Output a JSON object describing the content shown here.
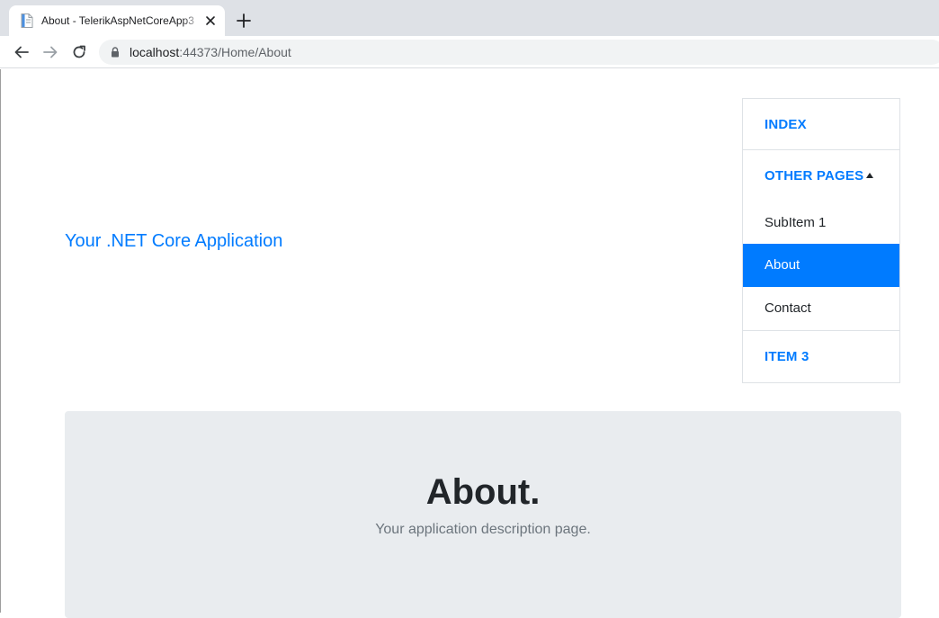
{
  "browser": {
    "tab": {
      "title": "About - TelerikAspNetCoreApp3",
      "favicon": "document-icon"
    },
    "address": {
      "host": "localhost",
      "path": ":44373/Home/About"
    },
    "icons": {
      "back": "arrow-left-icon",
      "forward": "arrow-right-icon",
      "reload": "reload-icon",
      "lock": "lock-icon",
      "close": "close-icon",
      "new_tab": "plus-icon"
    }
  },
  "header": {
    "brand": "Your .NET Core Application"
  },
  "menu": {
    "items": [
      {
        "label": "Index"
      },
      {
        "label": "Other Pages",
        "expanded": true,
        "children": [
          {
            "label": "SubItem 1"
          },
          {
            "label": "About",
            "active": true
          },
          {
            "label": "Contact"
          }
        ]
      },
      {
        "label": "Item 3"
      }
    ]
  },
  "main": {
    "title": "About.",
    "description": "Your application description page."
  },
  "colors": {
    "accent": "#007bff",
    "jumbotron_bg": "#e9ecef",
    "text": "#212529",
    "muted": "#6c757d"
  }
}
